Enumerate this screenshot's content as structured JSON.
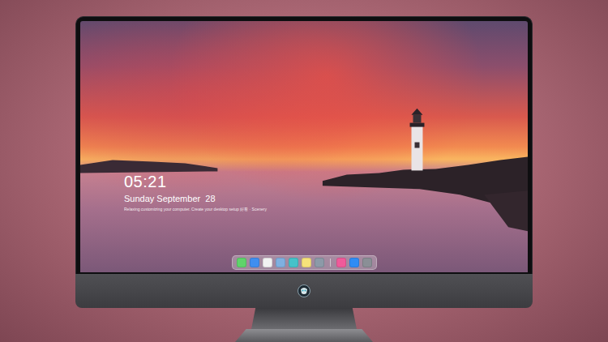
{
  "desktop": {
    "clock": "05:21",
    "date": "Sunday September  28",
    "caption": "Relaxing customizing your computer. Create your desktop setup 好看 · Scenery"
  },
  "dock": {
    "apps": [
      {
        "color": "#5fd36b"
      },
      {
        "color": "#3f8ef0"
      },
      {
        "color": "#f2f2f2"
      },
      {
        "color": "#7fb0e0"
      },
      {
        "color": "#45c2c9"
      },
      {
        "color": "#f6e27a"
      },
      {
        "color": "#8c9aa8"
      }
    ],
    "extras": [
      {
        "color": "#f05a9a"
      },
      {
        "color": "#2f8cf5"
      },
      {
        "color": "#8a8f96"
      }
    ]
  }
}
